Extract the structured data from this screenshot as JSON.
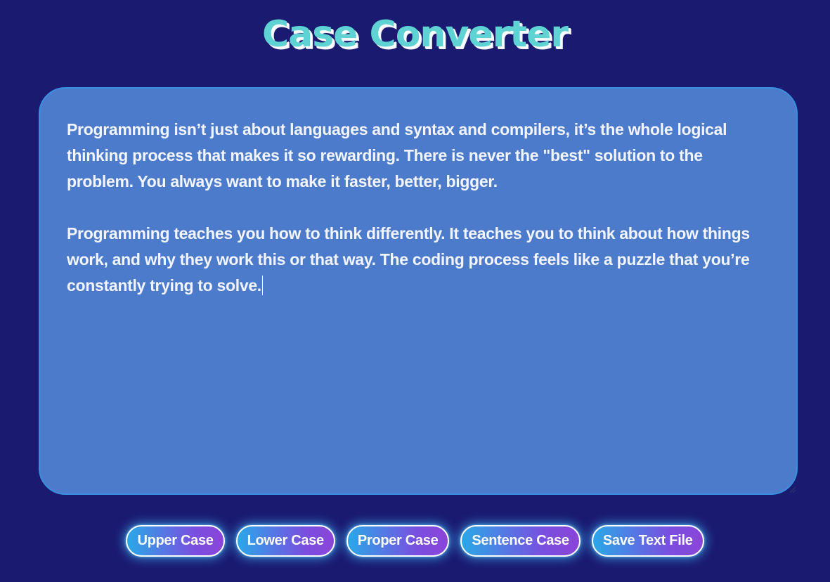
{
  "app": {
    "title": "Case Converter"
  },
  "editor": {
    "paragraphs": [
      "Programming isn’t just about languages and syntax and compilers, it’s the whole logical thinking process that makes it so rewarding. There is never the \"best\" solution to the problem. You always want to make it faster, better, bigger.",
      "Programming teaches you how to think differently. It teaches you to think about how things work, and why they work this or that way. The coding process feels like a puzzle that you’re constantly trying to solve."
    ]
  },
  "toolbar": {
    "upper_label": "Upper Case",
    "lower_label": "Lower Case",
    "proper_label": "Proper Case",
    "sentence_label": "Sentence Case",
    "save_label": "Save Text File"
  },
  "colors": {
    "background": "#1a1a70",
    "editor_background": "#4d7bcb",
    "title": "#5fd3d3",
    "button_gradient_start": "#2aa8e8",
    "button_gradient_end": "#8a45d8"
  },
  "icons": {
    "resize_grip": "resize-grip-icon"
  }
}
